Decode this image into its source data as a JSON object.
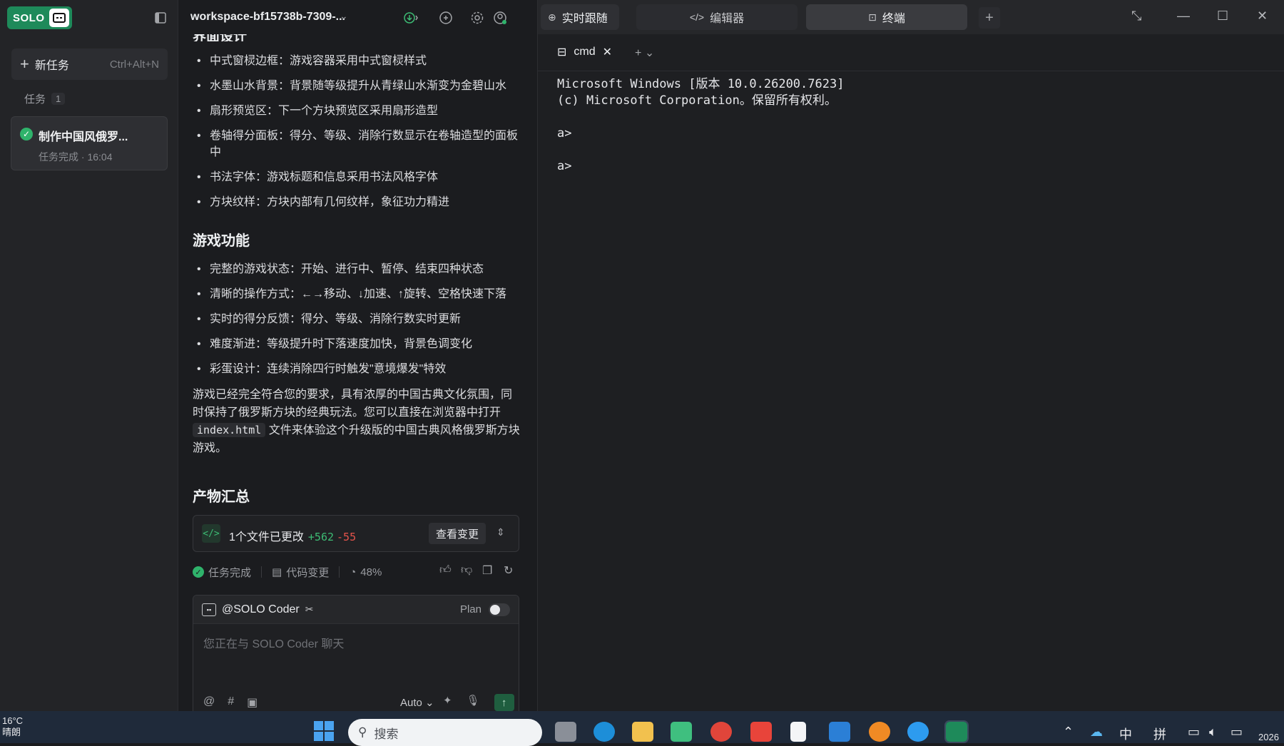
{
  "sidebar": {
    "logo_text": "SOLO",
    "new_task_label": "新任务",
    "new_task_shortcut": "Ctrl+Alt+N",
    "tasks_header": "任务",
    "tasks_count": "1",
    "task": {
      "title": "制作中国风俄罗...",
      "status": "任务完成 · 16:04"
    }
  },
  "chat": {
    "workspace": "workspace-bf15738b-7309-...",
    "cut_heading": "界面设计",
    "ui_bullets": [
      "中式窗棂边框：游戏容器采用中式窗棂样式",
      "水墨山水背景：背景随等级提升从青绿山水渐变为金碧山水",
      "扇形预览区：下一个方块预览区采用扇形造型",
      "卷轴得分面板：得分、等级、消除行数显示在卷轴造型的面板中",
      "书法字体：游戏标题和信息采用书法风格字体",
      "方块纹样：方块内部有几何纹样，象征功力精进"
    ],
    "features_title": "游戏功能",
    "feature_bullets": [
      "完整的游戏状态：开始、进行中、暂停、结束四种状态",
      "清晰的操作方式：←→移动、↓加速、↑旋转、空格快速下落",
      "实时的得分反馈：得分、等级、消除行数实时更新",
      "难度渐进：等级提升时下落速度加快，背景色调变化",
      "彩蛋设计：连续消除四行时触发\"意境爆发\"特效"
    ],
    "summary_p1": "游戏已经完全符合您的要求，具有浓厚的中国古典文化氛围，同时保持了俄罗斯方块的经典玩法。您可以直接在浏览器中打开",
    "summary_code": "index.html",
    "summary_p2": "文件来体验这个升级版的中国古典风格俄罗斯方块游戏。",
    "artifacts_title": "产物汇总",
    "changes": {
      "text": "1个文件已更改",
      "added": "+562",
      "removed": "-55",
      "view_label": "查看变更"
    },
    "status": {
      "done": "任务完成",
      "code_change": "代码变更",
      "progress": "48%"
    },
    "composer": {
      "agent": "@SOLO Coder",
      "plan_label": "Plan",
      "placeholder": "您正在与 SOLO Coder 聊天",
      "model": "Auto"
    }
  },
  "right": {
    "tabs": [
      "实时跟随",
      "编辑器",
      "终端"
    ],
    "terminal_tab": "cmd",
    "terminal_lines": "Microsoft Windows [版本 10.0.26200.7623]\n(c) Microsoft Corporation。保留所有权利。\n\na>\n\na>"
  },
  "taskbar": {
    "temperature": "16°C",
    "weather": "晴朗",
    "search_placeholder": "搜索",
    "ime_lang": "中",
    "ime_mode": "拼",
    "clock_partial": "2026"
  },
  "colors": {
    "accent_green": "#2fb36b",
    "added": "#3dbb74",
    "removed": "#e5534b",
    "taskbar": "#1f2a3a"
  }
}
